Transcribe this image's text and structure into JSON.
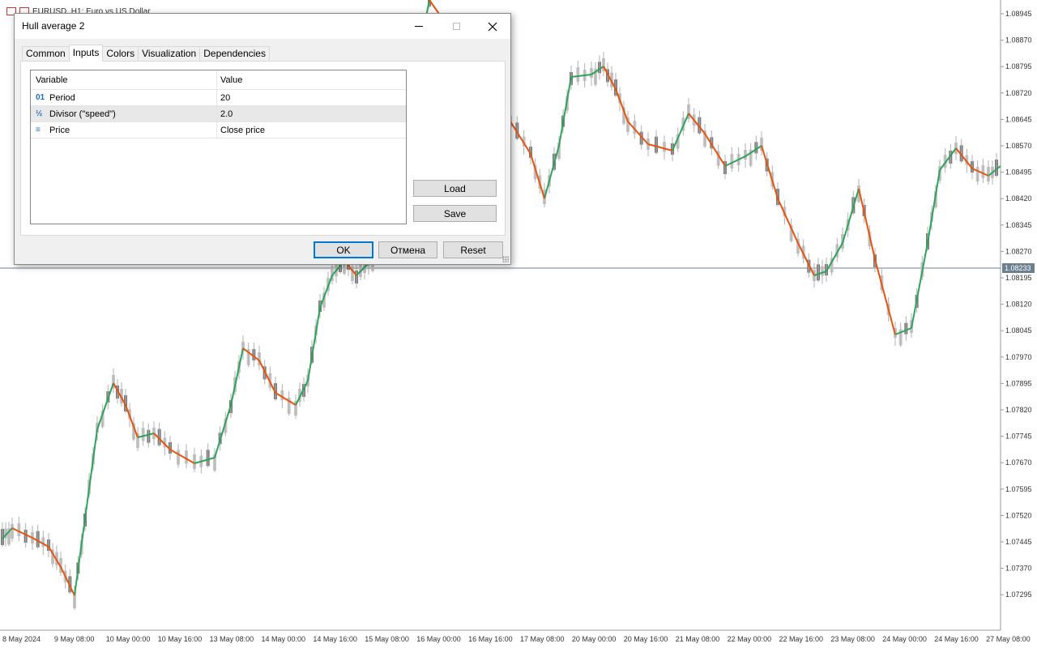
{
  "chart": {
    "title_text": "EURUSD, H1:  Euro vs US Dollar",
    "price_labels": [
      "1.08945",
      "1.08870",
      "1.08795",
      "1.08720",
      "1.08645",
      "1.08570",
      "1.08495",
      "1.08420",
      "1.08345",
      "1.08270",
      "1.08195",
      "1.08120",
      "1.08045",
      "1.07970",
      "1.07895",
      "1.07820",
      "1.07745",
      "1.07670",
      "1.07595",
      "1.07520",
      "1.07445",
      "1.07370",
      "1.07295"
    ],
    "current_price": "1.08233",
    "date_labels": [
      "8 May 2024",
      "9 May 08:00",
      "10 May 00:00",
      "10 May 16:00",
      "13 May 08:00",
      "14 May 00:00",
      "14 May 16:00",
      "15 May 08:00",
      "16 May 00:00",
      "16 May 16:00",
      "17 May 08:00",
      "20 May 00:00",
      "20 May 16:00",
      "21 May 08:00",
      "22 May 00:00",
      "22 May 16:00",
      "23 May 08:00",
      "24 May 00:00",
      "24 May 16:00",
      "27 May 08:00"
    ],
    "colors": {
      "up": "#2ea35a",
      "down": "#e8530e",
      "candle": "#c0c0c0",
      "current_line": "#6b7f8f"
    }
  },
  "dialog": {
    "title": "Hull average 2",
    "tabs": [
      {
        "label": "Common"
      },
      {
        "label": "Inputs",
        "active": true
      },
      {
        "label": "Colors"
      },
      {
        "label": "Visualization"
      },
      {
        "label": "Dependencies"
      }
    ],
    "grid": {
      "headers": {
        "variable": "Variable",
        "value": "Value"
      },
      "rows": [
        {
          "icon": "integer-icon",
          "glyph": "01",
          "name": "Period",
          "value": "20"
        },
        {
          "icon": "fraction-icon",
          "glyph": "½",
          "name": "Divisor (\"speed\")",
          "value": "2.0"
        },
        {
          "icon": "enum-icon",
          "glyph": "≡",
          "name": "Price",
          "value": "Close price"
        }
      ]
    },
    "buttons": {
      "load": "Load",
      "save": "Save",
      "ok": "OK",
      "cancel": "Отмена",
      "reset": "Reset"
    }
  }
}
